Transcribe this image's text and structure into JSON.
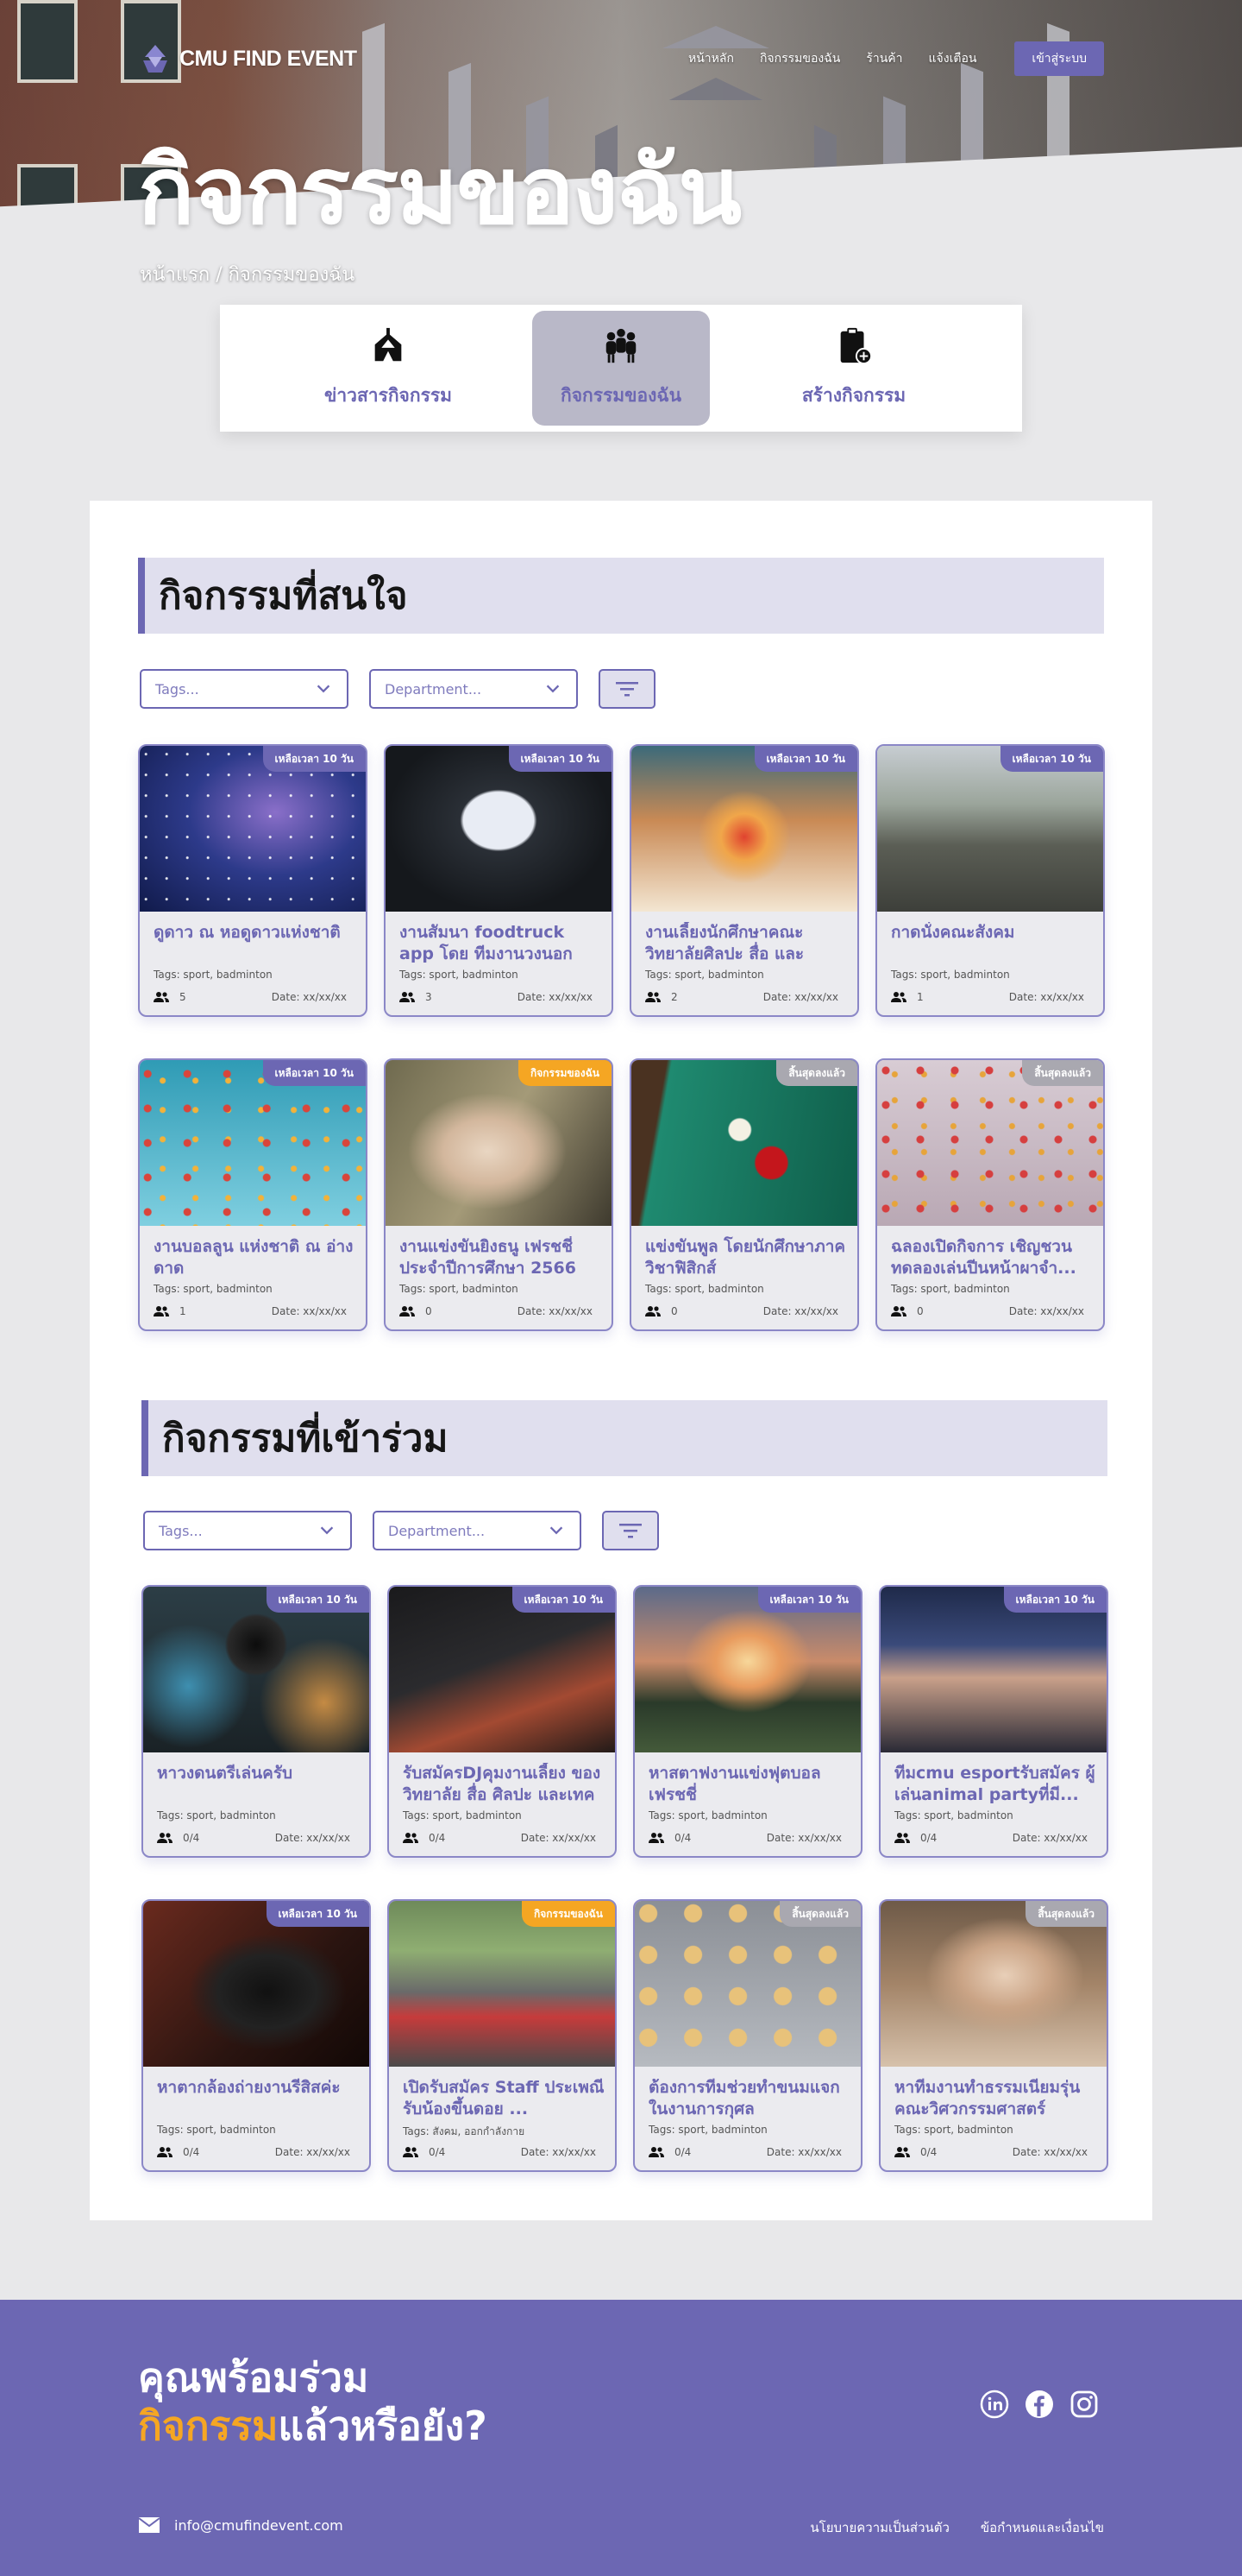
{
  "brand": {
    "name": "CMU FIND EVENT"
  },
  "nav": {
    "links": [
      "หน้าหลัก",
      "กิจกรรมของฉัน",
      "ร้านค้า",
      "แจ้งเตือน"
    ],
    "login": "เข้าสู่ระบบ"
  },
  "hero": {
    "title": "กิจกรรมของฉัน",
    "breadcrumb": "หน้าแรก / กิจกรรมของฉัน"
  },
  "tabs": [
    {
      "label": "ข่าวสารกิจกรรม",
      "icon": "tent-icon",
      "active": false
    },
    {
      "label": "กิจกรรมของฉัน",
      "icon": "group-icon",
      "active": true
    },
    {
      "label": "สร้างกิจกรรม",
      "icon": "clipboard-add-icon",
      "active": false
    }
  ],
  "filters": {
    "tags_placeholder": "Tags...",
    "department_placeholder": "Department..."
  },
  "colors": {
    "accent": "#6c67b3",
    "orange": "#f5a623",
    "gray_badge": "#a9a8b0",
    "card_bg": "#ebebef"
  },
  "sections": [
    {
      "title": "กิจกรรมที่สนใจ",
      "cards": [
        {
          "badge": "เหลือเวลา 10 วัน",
          "badge_type": "purple",
          "title": "ดูดาว ณ หอดูดาวแห่งชาติ",
          "tags": "Tags: sport, badminton",
          "count": "5",
          "date": "Date: xx/xx/xx",
          "scene": "stars"
        },
        {
          "badge": "เหลือเวลา 10 วัน",
          "badge_type": "purple",
          "title": "งานสัมนา foodtruck app โดย ทีมงานวงนอก",
          "tags": "Tags: sport, badminton",
          "count": "3",
          "date": "Date: xx/xx/xx",
          "scene": "seminar"
        },
        {
          "badge": "เหลือเวลา 10 วัน",
          "badge_type": "purple",
          "title": "งานเลี้ยงนักศึกษาคณะวิทยาลัยศิลปะ สื่อ และเทคโนโลยี...",
          "tags": "Tags: sport, badminton",
          "count": "2",
          "date": "Date: xx/xx/xx",
          "scene": "dinner"
        },
        {
          "badge": "เหลือเวลา 10 วัน",
          "badge_type": "purple",
          "title": "กาดนั่งคณะสังคม",
          "tags": "Tags: sport, badminton",
          "count": "1",
          "date": "Date: xx/xx/xx",
          "scene": "market"
        },
        {
          "badge": "เหลือเวลา 10 วัน",
          "badge_type": "purple",
          "title": "งานบอลลูน แห่งชาติ ณ อ่างดาด",
          "tags": "Tags: sport, badminton",
          "count": "1",
          "date": "Date: xx/xx/xx",
          "scene": "balloons"
        },
        {
          "badge": "กิจกรรมของฉัน",
          "badge_type": "orange",
          "title": "งานแข่งขันยิงธนู เฟรชชี่ ประจำปีการศึกษา 2566",
          "tags": "Tags: sport, badminton",
          "count": "0",
          "date": "Date: xx/xx/xx",
          "scene": "archery"
        },
        {
          "badge": "สิ้นสุดลงแล้ว",
          "badge_type": "gray",
          "title": "แข่งขันพูล โดยนักศึกษาภาควิชาฟิสิกส์",
          "tags": "Tags: sport, badminton",
          "count": "0",
          "date": "Date: xx/xx/xx",
          "scene": "pool"
        },
        {
          "badge": "สิ้นสุดลงแล้ว",
          "badge_type": "gray",
          "title": "ฉลองเปิดกิจการ เชิญชวน ทดลองเล่นปีนหน้าผาจำ...",
          "tags": "Tags: sport, badminton",
          "count": "0",
          "date": "Date: xx/xx/xx",
          "scene": "climb"
        }
      ]
    },
    {
      "title": "กิจกรรมที่เข้าร่วม",
      "cards": [
        {
          "badge": "เหลือเวลา 10 วัน",
          "badge_type": "purple",
          "title": "หาวงดนตรีเล่นครับ",
          "tags": "Tags: sport, badminton",
          "count": "0/4",
          "date": "Date: xx/xx/xx",
          "scene": "mic"
        },
        {
          "badge": "เหลือเวลา 10 วัน",
          "badge_type": "purple",
          "title": "รับสมัครDJคุมงานเลี้ยง ของวิทยาลัย สื่อ ศิลปะ และเทคโน...",
          "tags": "Tags: sport, badminton",
          "count": "0/4",
          "date": "Date: xx/xx/xx",
          "scene": "dj"
        },
        {
          "badge": "เหลือเวลา 10 วัน",
          "badge_type": "purple",
          "title": "หาสตาฟงานแข่งฟุตบอล เฟรชชี่",
          "tags": "Tags: sport, badminton",
          "count": "0/4",
          "date": "Date: xx/xx/xx",
          "scene": "stadium"
        },
        {
          "badge": "เหลือเวลา 10 วัน",
          "badge_type": "purple",
          "title": "ทีมcmu esportรับสมัคร ผู้เล่นanimal partyที่มี...",
          "tags": "Tags: sport, badminton",
          "count": "0/4",
          "date": "Date: xx/xx/xx",
          "scene": "esport"
        },
        {
          "badge": "เหลือเวลา 10 วัน",
          "badge_type": "purple",
          "title": "หาตากล้องถ่ายงานรีสิสค่ะ",
          "tags": "Tags: sport, badminton",
          "count": "0/4",
          "date": "Date: xx/xx/xx",
          "scene": "camera"
        },
        {
          "badge": "กิจกรรมของฉัน",
          "badge_type": "orange",
          "title": "เปิดรับสมัคร Staff ประเพณีรับน้องขึ้นดอย ...",
          "tags": "Tags: สังคม, ออกกำลังกาย",
          "count": "0/4",
          "date": "Date: xx/xx/xx",
          "scene": "cycling"
        },
        {
          "badge": "สิ้นสุดลงแล้ว",
          "badge_type": "gray",
          "title": "ต้องการทีมช่วยทำขนมแจก ในงานการกุศล",
          "tags": "Tags: sport, badminton",
          "count": "0/4",
          "date": "Date: xx/xx/xx",
          "scene": "cookies"
        },
        {
          "badge": "สิ้นสุดลงแล้ว",
          "badge_type": "gray",
          "title": "หาทีมงานทำธรรมเนียมรุ่น คณะวิศวกรรมศาสตร์",
          "tags": "Tags: sport, badminton",
          "count": "0/4",
          "date": "Date: xx/xx/xx",
          "scene": "cafe"
        }
      ]
    }
  ],
  "footer": {
    "cta_line1": "คุณพร้อมร่วม",
    "cta_accent": "กิจกรรม",
    "cta_rest": "แล้วหรือยัง?",
    "email": "info@cmufindevent.com",
    "privacy": "นโยบายความเป็นส่วนตัว",
    "terms": "ข้อกำหนดและเงื่อนไข",
    "socials": [
      "linkedin-icon",
      "facebook-icon",
      "instagram-icon"
    ]
  }
}
